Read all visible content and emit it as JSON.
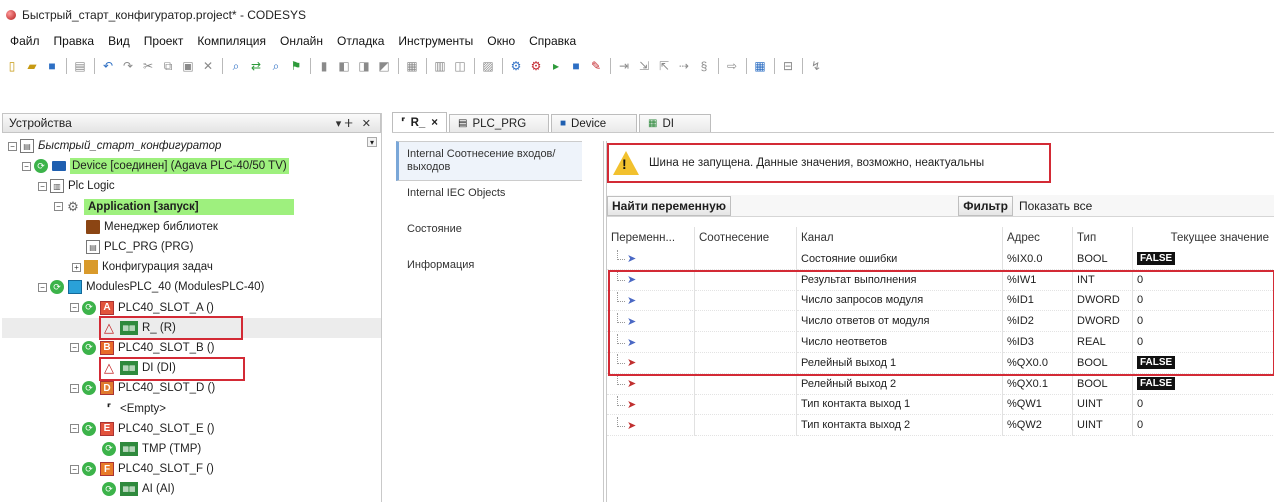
{
  "window": {
    "title": "Быстрый_старт_конфигуратор.project* - CODESYS"
  },
  "menu": [
    "Файл",
    "Правка",
    "Вид",
    "Проект",
    "Компиляция",
    "Онлайн",
    "Отладка",
    "Инструменты",
    "Окно",
    "Справка"
  ],
  "devices_panel": {
    "title": "Устройства",
    "pin": "▾ ⵜ",
    "close": "✕",
    "tree": [
      {
        "label": "Быстрый_старт_конфигуратор",
        "icon": "project-icon"
      },
      {
        "label": "Device [соединен] (Agava PLC-40/50 TV)",
        "icon": "device-icon"
      },
      {
        "label": "Plc Logic",
        "icon": "plc-logic-icon"
      },
      {
        "label": "Application [запуск]",
        "icon": "application-icon"
      },
      {
        "label": "Менеджер библиотек",
        "icon": "library-icon"
      },
      {
        "label": "PLC_PRG (PRG)",
        "icon": "program-icon"
      },
      {
        "label": "Конфигурация задач",
        "icon": "task-config-icon"
      },
      {
        "label": "ModulesPLC_40 (ModulesPLC-40)",
        "icon": "modules-icon"
      },
      {
        "label": "PLC40_SLOT_A ()",
        "badge": "A"
      },
      {
        "label": "R_ (R)",
        "icon": "module-icon"
      },
      {
        "label": "PLC40_SLOT_B ()",
        "badge": "B"
      },
      {
        "label": "DI (DI)",
        "icon": "module-icon"
      },
      {
        "label": "PLC40_SLOT_D ()",
        "badge": "D"
      },
      {
        "label": "<Empty>",
        "icon": "empty-slot-icon"
      },
      {
        "label": "PLC40_SLOT_E ()",
        "badge": "E"
      },
      {
        "label": "TMP (TMP)",
        "icon": "module-icon"
      },
      {
        "label": "PLC40_SLOT_F ()",
        "badge": "F"
      },
      {
        "label": "AI (AI)",
        "icon": "module-icon"
      }
    ]
  },
  "tabs": [
    {
      "label": "R_",
      "icon": "module-tab-icon",
      "active": true,
      "close": "×"
    },
    {
      "label": "PLC_PRG",
      "icon": "program-tab-icon",
      "active": false
    },
    {
      "label": "Device",
      "icon": "device-tab-icon",
      "active": false
    },
    {
      "label": "DI",
      "icon": "module-tab-icon",
      "active": false
    }
  ],
  "side_tabs": [
    {
      "label": "Internal Соотнесение входов/выходов",
      "active": true
    },
    {
      "label": "Internal IEC Objects",
      "active": false
    },
    {
      "label": "Состояние",
      "active": false
    },
    {
      "label": "Информация",
      "active": false
    }
  ],
  "warning": {
    "text": "Шина не запущена. Данные значения, возможно, неактуальны",
    "icon": "warning-icon"
  },
  "filter_bar": {
    "find_label": "Найти переменную",
    "filter_label": "Фильтр",
    "filter_value": "Показать все"
  },
  "grid": {
    "columns": [
      "Переменн...",
      "Соотнесение",
      "Канал",
      "Адрес",
      "Тип",
      "Текущее значение"
    ],
    "rows": [
      {
        "channel": "Состояние ошибки",
        "address": "%IX0.0",
        "type": "BOOL",
        "value": "FALSE",
        "badge": true,
        "dir": "in"
      },
      {
        "channel": "Результат выполнения",
        "address": "%IW1",
        "type": "INT",
        "value": "0",
        "badge": false,
        "dir": "in"
      },
      {
        "channel": "Число запросов модуля",
        "address": "%ID1",
        "type": "DWORD",
        "value": "0",
        "badge": false,
        "dir": "in"
      },
      {
        "channel": "Число ответов от модуля",
        "address": "%ID2",
        "type": "DWORD",
        "value": "0",
        "badge": false,
        "dir": "in"
      },
      {
        "channel": "Число неответов",
        "address": "%ID3",
        "type": "REAL",
        "value": "0",
        "badge": false,
        "dir": "in"
      },
      {
        "channel": "Релейный выход 1",
        "address": "%QX0.0",
        "type": "BOOL",
        "value": "FALSE",
        "badge": true,
        "dir": "out"
      },
      {
        "channel": "Релейный выход 2",
        "address": "%QX0.1",
        "type": "BOOL",
        "value": "FALSE",
        "badge": true,
        "dir": "out"
      },
      {
        "channel": "Тип контакта выход 1",
        "address": "%QW1",
        "type": "UINT",
        "value": "0",
        "badge": false,
        "dir": "out"
      },
      {
        "channel": "Тип контакта выход 2",
        "address": "%QW2",
        "type": "UINT",
        "value": "0",
        "badge": false,
        "dir": "out"
      }
    ]
  },
  "colors": {
    "highlight_green": "#9ef07e",
    "warning_border": "#d32a35",
    "value_badge": "#111111"
  }
}
